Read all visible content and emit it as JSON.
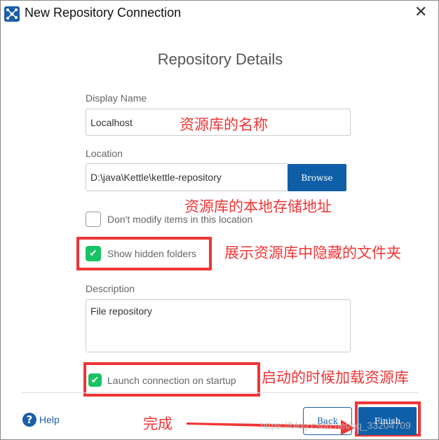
{
  "window": {
    "title": "New Repository Connection",
    "close": "✕"
  },
  "heading": "Repository Details",
  "display_name": {
    "label": "Display Name",
    "value": "Localhost"
  },
  "location": {
    "label": "Location",
    "value": "D:\\java\\Kettle\\kettle-repository",
    "browse": "Browse"
  },
  "dont_modify": {
    "label": "Don't modify items in this location",
    "checked": false
  },
  "show_hidden": {
    "label": "Show hidden folders",
    "checked": true
  },
  "description": {
    "label": "Description",
    "value": "File repository"
  },
  "launch": {
    "label": "Launch connection on startup",
    "checked": true
  },
  "footer": {
    "help": "Help",
    "back": "Back",
    "finish": "Finish"
  },
  "annotations": {
    "name": "资源库的名称",
    "location": "资源库的本地存储地址",
    "hidden": "展示资源库中隐藏的文件夹",
    "launch": "启动的时候加载资源库",
    "finish": "完成"
  },
  "watermark": "https://blog.csdn.net/qq_33204709",
  "colors": {
    "accent": "#0f5fa8",
    "check": "#16c464",
    "annotation": "#f03535"
  }
}
